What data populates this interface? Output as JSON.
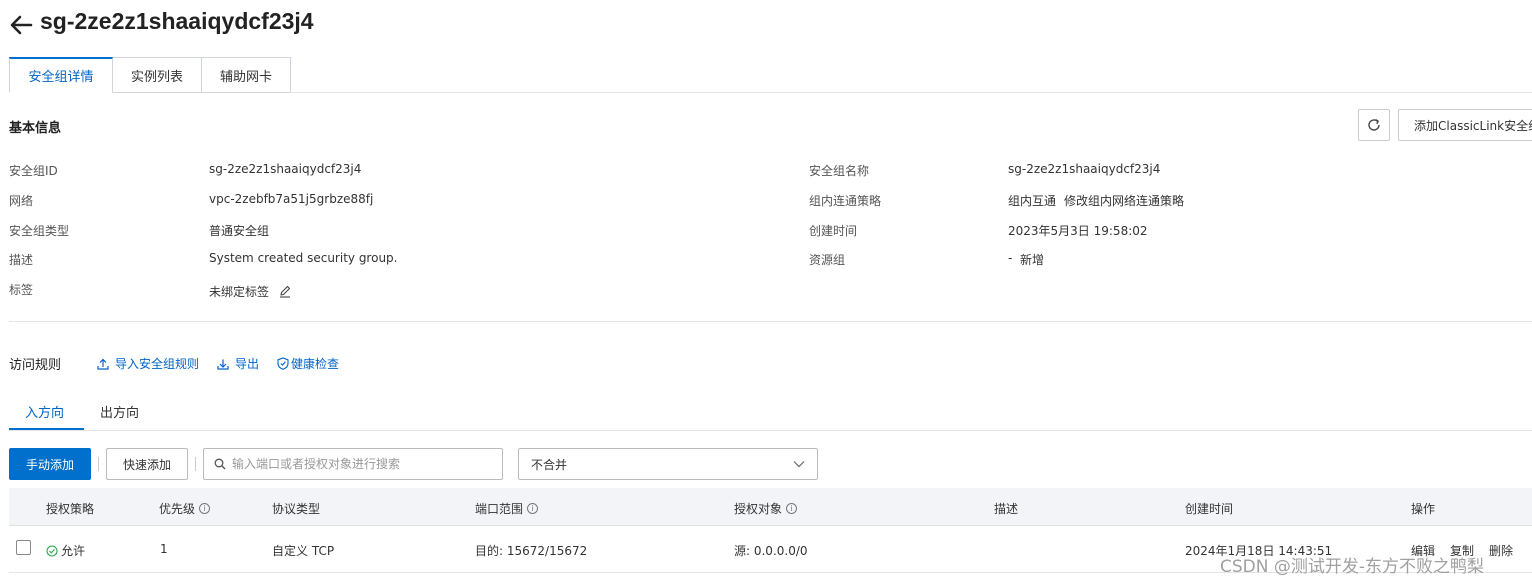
{
  "header": {
    "title": "sg-2ze2z1shaaiqydcf23j4"
  },
  "tabs": [
    {
      "label": "安全组详情"
    },
    {
      "label": "实例列表"
    },
    {
      "label": "辅助网卡"
    }
  ],
  "basic_info": {
    "title": "基本信息",
    "classiclink_button": "添加ClassicLink安全组",
    "left": [
      {
        "label": "安全组ID",
        "value": "sg-2ze2z1shaaiqydcf23j4"
      },
      {
        "label": "网络",
        "value": "vpc-2zebfb7a51j5grbze88fj"
      },
      {
        "label": "安全组类型",
        "value": "普通安全组"
      },
      {
        "label": "描述",
        "value": "System created security group."
      },
      {
        "label": "标签",
        "value": "未绑定标签"
      }
    ],
    "right": [
      {
        "label": "安全组名称",
        "value": "sg-2ze2z1shaaiqydcf23j4"
      },
      {
        "label": "组内连通策略",
        "value": "组内互通",
        "link": "修改组内网络连通策略"
      },
      {
        "label": "创建时间",
        "value": "2023年5月3日 19:58:02"
      },
      {
        "label": "资源组",
        "value": "-",
        "link": "新增"
      }
    ]
  },
  "rules": {
    "title": "访问规则",
    "actions": {
      "import": "导入安全组规则",
      "export": "导出",
      "health": "健康检查"
    },
    "sub_tabs": {
      "inbound": "入方向",
      "outbound": "出方向"
    },
    "toolbar": {
      "manual_add": "手动添加",
      "quick_add": "快速添加",
      "search_placeholder": "输入端口或者授权对象进行搜索",
      "merge_select": "不合并"
    },
    "columns": {
      "policy": "授权策略",
      "priority": "优先级",
      "protocol": "协议类型",
      "port": "端口范围",
      "object": "授权对象",
      "desc": "描述",
      "created": "创建时间",
      "ops": "操作"
    },
    "row": {
      "policy": "允许",
      "priority": "1",
      "protocol": "自定义 TCP",
      "port": "目的: 15672/15672",
      "object": "源: 0.0.0.0/0",
      "created": "2024年1月18日 14:43:51",
      "edit": "编辑",
      "copy": "复制",
      "delete": "删除"
    }
  },
  "watermark": "CSDN @测试开发-东方不败之鸭梨",
  "colors": {
    "accent": "#0070cc",
    "link": "#0064c8",
    "success": "#2aa94b"
  }
}
